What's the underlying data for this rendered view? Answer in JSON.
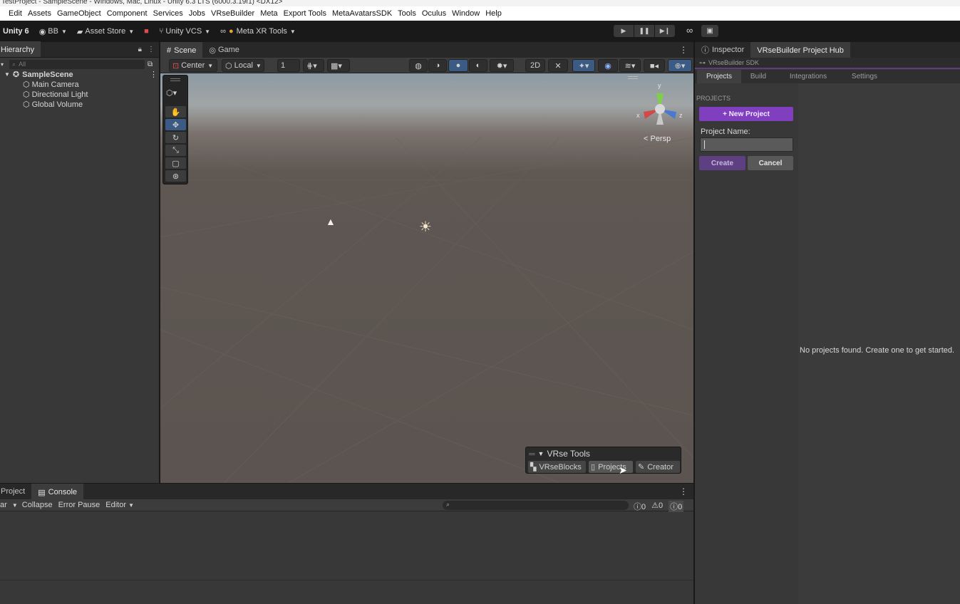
{
  "window_title": "TestProject - SampleScene - Windows, Mac, Linux - Unity 6.3 LTS (6000.3.19f1) <DX12>",
  "menu": [
    "Edit",
    "Assets",
    "GameObject",
    "Component",
    "Services",
    "Jobs",
    "VRseBuilder",
    "Meta",
    "Export Tools",
    "MetaAvatarsSDK",
    "Tools",
    "Oculus",
    "Window",
    "Help"
  ],
  "toolbar": {
    "unity_label": "Unity 6",
    "account": "BB",
    "asset_store": "Asset Store",
    "vcs": "Unity VCS",
    "meta_xr": "Meta XR Tools"
  },
  "hierarchy": {
    "tab": "Hierarchy",
    "search_placeholder": "All",
    "scene": "SampleScene",
    "objects": [
      "Main Camera",
      "Directional Light",
      "Global Volume"
    ]
  },
  "scene_view": {
    "tabs": [
      "Scene",
      "Game"
    ],
    "pivot": "Center",
    "space": "Local",
    "grid_snap": "1",
    "persp_label": "< Persp",
    "gizmo_axes": {
      "x": "x",
      "y": "y",
      "z": "z"
    }
  },
  "vrse_tools": {
    "title": "VRse Tools",
    "buttons": [
      "VRseBlocks",
      "Projects",
      "Creator"
    ]
  },
  "bottom": {
    "tabs": [
      "Project",
      "Console"
    ],
    "console_buttons": [
      "ar",
      "Collapse",
      "Error Pause",
      "Editor"
    ],
    "counts": {
      "errors": "0",
      "warnings": "0",
      "messages": "0"
    }
  },
  "right_panel": {
    "tabs": [
      "Inspector",
      "VRseBuilder Project Hub"
    ],
    "sdk_label": "VRseBuilder SDK",
    "subtabs": [
      "Projects",
      "Build",
      "Integrations",
      "Settings"
    ],
    "section_label": "PROJECTS",
    "new_project_btn": "+ New Project",
    "project_name_label": "Project Name:",
    "project_name_value": "",
    "create_btn": "Create",
    "cancel_btn": "Cancel",
    "empty_message": "No projects found. Create one to get started."
  },
  "colors": {
    "accent_purple": "#7f3fbf",
    "selected_blue": "#3b5a84",
    "panel": "#383838"
  }
}
